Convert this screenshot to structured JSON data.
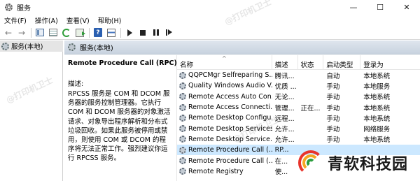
{
  "window": {
    "title": "服务",
    "minimize_glyph": "—",
    "maximize_glyph": "☐",
    "close_glyph": "✕"
  },
  "menu": [
    "文件(F)",
    "操作(A)",
    "查看(V)",
    "帮助(H)"
  ],
  "toolbar": {
    "back_glyph": "←",
    "forward_glyph": "→",
    "help_glyph": "?"
  },
  "tree": {
    "root_label": "服务(本地)"
  },
  "pane": {
    "title": "服务(本地)"
  },
  "detail": {
    "service_name": "Remote Procedure Call (RPC)",
    "description_label": "描述:",
    "description": "RPCSS 服务是 COM 和 DCOM 服务器的服务控制管理器。它执行 COM 和 DCOM 服务器的对象激活请求、对象导出程序解析和分布式垃圾回收。如果此服务被停用或禁用，则使用 COM 或 DCOM 的程序将无法正常工作。强烈建议你运行 RPCSS 服务。"
  },
  "table": {
    "sort_glyph": "^",
    "columns": [
      "名称",
      "描述",
      "状态",
      "启动类型",
      "登录为"
    ],
    "rows": [
      {
        "name": "QQPCMgr Selfreparing S...",
        "desc": "腾讯...",
        "status": "",
        "startup": "自动",
        "logon": "本地系统"
      },
      {
        "name": "Quality Windows Audio V...",
        "desc": "优质 ...",
        "status": "",
        "startup": "手动",
        "logon": "本地服务"
      },
      {
        "name": "Remote Access Auto Con...",
        "desc": "无论...",
        "status": "",
        "startup": "手动",
        "logon": "本地系统"
      },
      {
        "name": "Remote Access Connecti...",
        "desc": "管理...",
        "status": "正在...",
        "startup": "手动",
        "logon": "本地系统"
      },
      {
        "name": "Remote Desktop Configu...",
        "desc": "远程...",
        "status": "",
        "startup": "手动",
        "logon": "本地系统"
      },
      {
        "name": "Remote Desktop Services",
        "desc": "允许...",
        "status": "",
        "startup": "手动",
        "logon": "网络服务"
      },
      {
        "name": "Remote Desktop Service...",
        "desc": "允许...",
        "status": "",
        "startup": "手动",
        "logon": "本地系统"
      },
      {
        "name": "Remote Procedure Call (...",
        "desc": "RP...",
        "status": "",
        "startup": "",
        "logon": ""
      },
      {
        "name": "Remote Procedure Call (...",
        "desc": "在...",
        "status": "",
        "startup": "",
        "logon": ""
      },
      {
        "name": "Remote Registry",
        "desc": "使...",
        "status": "",
        "startup": "",
        "logon": ""
      }
    ],
    "selected_index": 7
  },
  "watermarks": [
    "@打印机卫士",
    "@打印机卫士",
    "@打印机卫士"
  ],
  "logo": {
    "text": "青软科技园"
  },
  "colors": {
    "selection": "#cce8ff",
    "header_gradient_top": "#dfe6ee",
    "logo_red": "#e8332b",
    "logo_orange": "#f5a623",
    "logo_green": "#2a9d3c"
  }
}
